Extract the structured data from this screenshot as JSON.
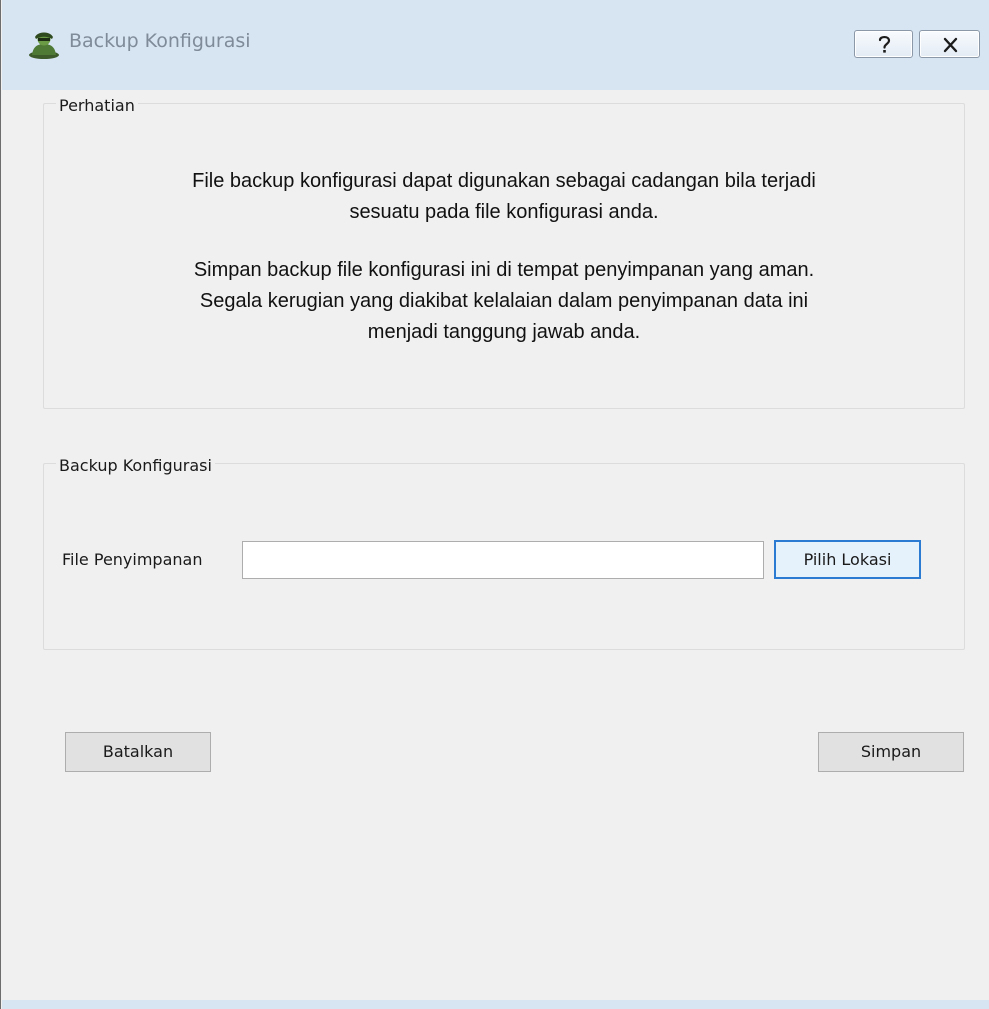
{
  "window": {
    "title": "Backup Konfigurasi",
    "app_icon": "user-icon",
    "help_icon": "question-mark-icon",
    "close_icon": "close-x-icon"
  },
  "notice_group": {
    "title": "Perhatian",
    "paragraph_1": [
      "File backup konfigurasi dapat digunakan sebagai cadangan bila terjadi",
      "sesuatu pada file konfigurasi anda."
    ],
    "paragraph_2": [
      "Simpan backup file konfigurasi ini di tempat penyimpanan yang aman.",
      "Segala kerugian yang diakibat kelalaian dalam penyimpanan data ini",
      "menjadi tanggung jawab anda."
    ]
  },
  "backup_group": {
    "title": "Backup Konfigurasi",
    "file_label": "File Penyimpanan",
    "file_value": "",
    "choose_button": "Pilih Lokasi"
  },
  "footer": {
    "cancel_button": "Batalkan",
    "save_button": "Simpan"
  },
  "colors": {
    "titlebar": "#d7e4f2",
    "window_body": "#f0f0f0",
    "focus_border": "#2b7bd3"
  }
}
